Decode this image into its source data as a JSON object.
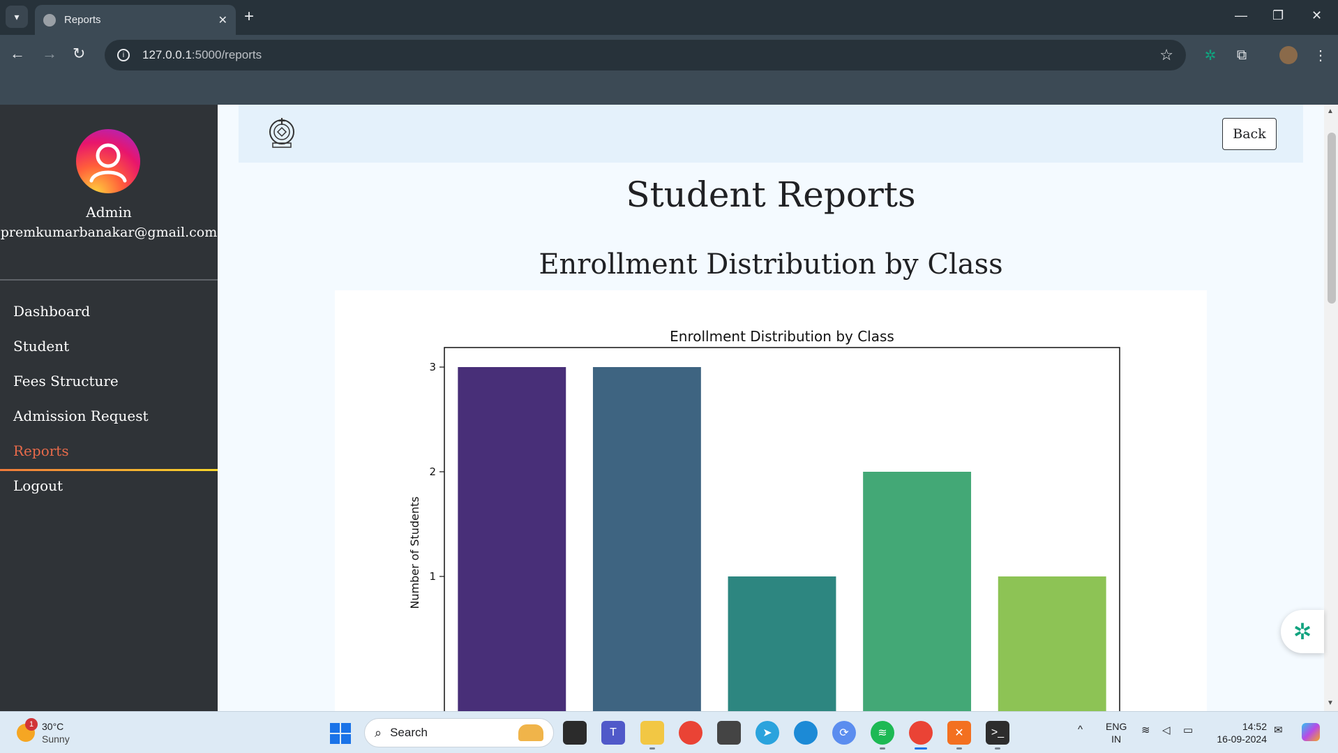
{
  "browser": {
    "tab_title": "Reports",
    "url_host": "127.0.0.1",
    "url_rest": ":5000/reports"
  },
  "sidebar": {
    "user_name": "Admin",
    "user_email": "premkumarbanakar@gmail.com",
    "items": [
      {
        "label": "Dashboard"
      },
      {
        "label": "Student"
      },
      {
        "label": "Fees Structure"
      },
      {
        "label": "Admission Request"
      },
      {
        "label": "Reports",
        "active": true
      },
      {
        "label": "Logout"
      }
    ]
  },
  "header": {
    "back_label": "Back"
  },
  "main": {
    "page_title": "Student Reports",
    "section_title": "Enrollment Distribution by Class"
  },
  "chart_data": {
    "type": "bar",
    "title": "Enrollment Distribution by Class",
    "xlabel": "",
    "ylabel": "Number of Students",
    "categories": [
      "",
      "",
      "",
      "",
      ""
    ],
    "values": [
      3,
      3,
      1,
      2,
      1
    ],
    "colors": [
      "#482f78",
      "#3e6481",
      "#2d8680",
      "#43a876",
      "#8dc355"
    ],
    "yticks": [
      1,
      2,
      3
    ],
    "grid": false
  },
  "taskbar": {
    "weather_temp": "30°C",
    "weather_cond": "Sunny",
    "weather_badge": "1",
    "search_placeholder": "Search",
    "lang_line1": "ENG",
    "lang_line2": "IN",
    "time": "14:52",
    "date": "16-09-2024"
  },
  "colors": {
    "sidebar_bg": "#2f3337",
    "active_menu": "#e76a4a",
    "header_strip": "#e4f1fb",
    "page_bg": "#f4faff"
  }
}
